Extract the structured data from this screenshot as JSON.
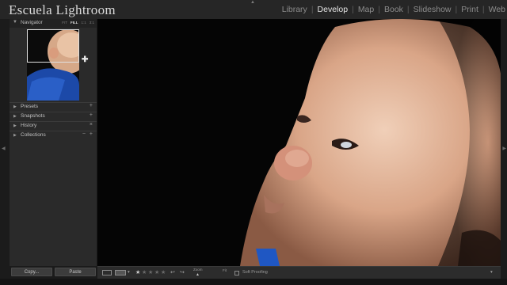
{
  "app": {
    "identity_plate": "Escuela Lightroom",
    "modules": [
      {
        "label": "Library",
        "active": false
      },
      {
        "label": "Develop",
        "active": true
      },
      {
        "label": "Map",
        "active": false
      },
      {
        "label": "Book",
        "active": false
      },
      {
        "label": "Slideshow",
        "active": false
      },
      {
        "label": "Print",
        "active": false
      },
      {
        "label": "Web",
        "active": false
      }
    ]
  },
  "navigator": {
    "title": "Navigator",
    "zoom_options": [
      "FIT",
      "FILL",
      "1:1",
      "3:1"
    ],
    "selected_zoom": "FILL"
  },
  "left_panel": {
    "sections": [
      {
        "label": "Presets",
        "action": "+"
      },
      {
        "label": "Snapshots",
        "action": "+"
      },
      {
        "label": "History",
        "action": "×"
      },
      {
        "label": "Collections",
        "action": "+",
        "action2": "−"
      }
    ],
    "copy_button": "Copy...",
    "paste_button": "Paste"
  },
  "toolbar": {
    "rating": 1,
    "rating_max": 5,
    "zoom_label": "Zoom",
    "zoom_fit": "Fit",
    "soft_proofing_label": "Soft Proofing"
  },
  "colors": {
    "background": "#1b1b1b",
    "panel": "#2a2a2a",
    "active_module": "#e6e6e6",
    "inactive_module": "#8c8c8c"
  }
}
